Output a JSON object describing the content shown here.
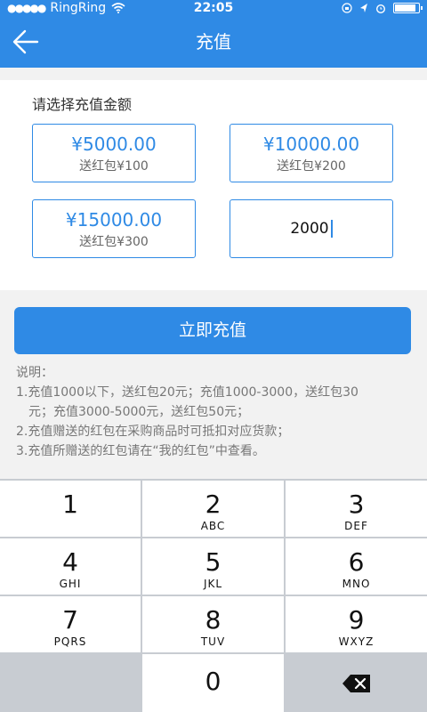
{
  "status_bar": {
    "signal": "●●●●●",
    "carrier": "RingRing",
    "time": "22:05",
    "battery_level": 0.95
  },
  "nav": {
    "title": "充值",
    "back_icon": "arrow-left-icon"
  },
  "recharge": {
    "heading": "请选择充值金额",
    "options": [
      {
        "amount": "¥5000.00",
        "gift": "送红包¥100"
      },
      {
        "amount": "¥10000.00",
        "gift": "送红包¥200"
      },
      {
        "amount": "¥15000.00",
        "gift": "送红包¥300"
      }
    ],
    "custom_value": "2000"
  },
  "cta": {
    "label": "立即充值"
  },
  "notes": {
    "title": "说明：",
    "lines": [
      "1.充值1000以下，送红包20元；充值1000-3000，送红包30",
      "元；充值3000-5000元，送红包50元；",
      "2.充值赠送的红包在采购商品时可抵扣对应货款；",
      "3.充值所赠送的红包请在“我的红包”中查看。"
    ]
  },
  "keypad": {
    "keys": [
      {
        "num": "1",
        "letters": ""
      },
      {
        "num": "2",
        "letters": "ABC"
      },
      {
        "num": "3",
        "letters": "DEF"
      },
      {
        "num": "4",
        "letters": "GHI"
      },
      {
        "num": "5",
        "letters": "JKL"
      },
      {
        "num": "6",
        "letters": "MNO"
      },
      {
        "num": "7",
        "letters": "PQRS"
      },
      {
        "num": "8",
        "letters": "TUV"
      },
      {
        "num": "9",
        "letters": "WXYZ"
      },
      {
        "num": "0",
        "letters": ""
      }
    ],
    "delete_icon": "backspace-icon"
  },
  "colors": {
    "accent": "#2f8ae5",
    "keypad_bg": "#c8ccd2"
  }
}
